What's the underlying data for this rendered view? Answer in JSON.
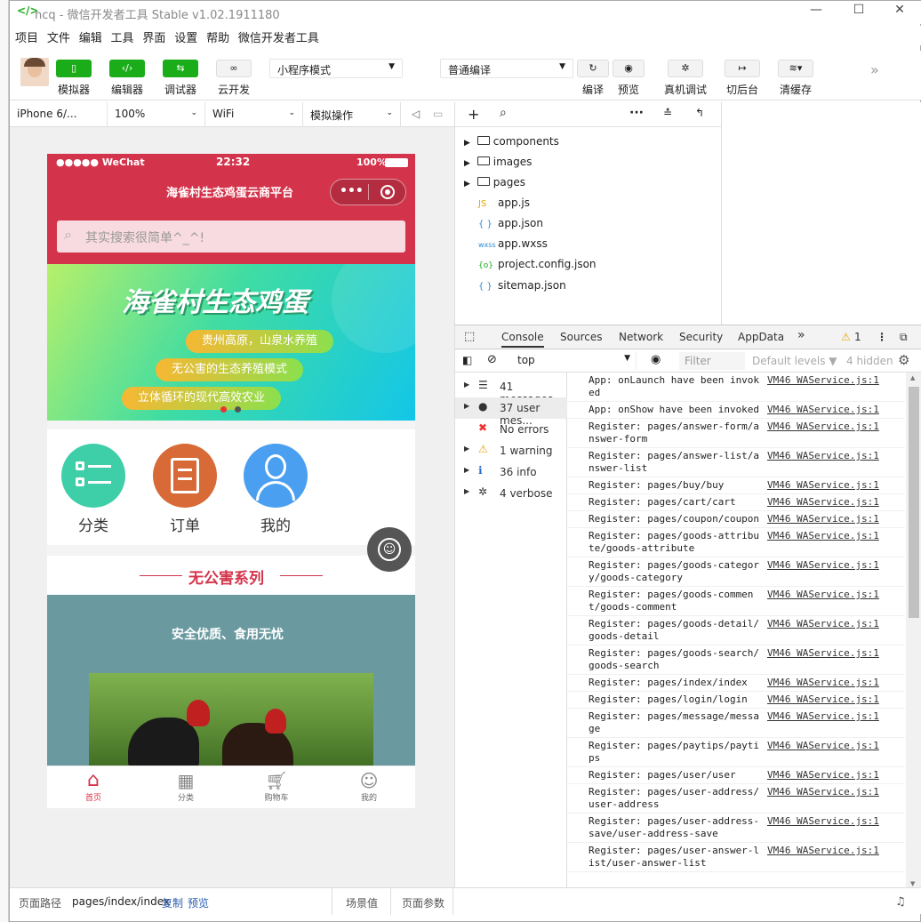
{
  "window": {
    "title": "hcq - 微信开发者工具 Stable v1.02.1911180",
    "logo": "</>"
  },
  "menu": [
    "项目",
    "文件",
    "编辑",
    "工具",
    "界面",
    "设置",
    "帮助",
    "微信开发者工具"
  ],
  "toolbar": {
    "simulator": "模拟器",
    "editor": "编辑器",
    "debugger": "调试器",
    "cloud": "云开发",
    "mode_select": "小程序模式",
    "compile_select": "普通编译",
    "compile": "编译",
    "preview": "预览",
    "remote_debug": "真机调试",
    "backstage": "切后台",
    "clear_cache": "清缓存"
  },
  "sim_header": {
    "device": "iPhone 6/...",
    "zoom": "100%",
    "network": "WiFi",
    "sim_ops": "模拟操作"
  },
  "phone": {
    "status": {
      "carrier": "●●●●● WeChat",
      "time": "22:32",
      "battery": "100%"
    },
    "nav_title": "海雀村生态鸡蛋云商平台",
    "search_placeholder": "其实搜索很简单^_^!",
    "banner": {
      "title": "海雀村生态鸡蛋",
      "line1": "贵州高原，山泉水养殖",
      "line2": "无公害的生态养殖模式",
      "line3": "立体循环的现代高效农业"
    },
    "categories": [
      {
        "label": "分类",
        "color": "#3ecfa9"
      },
      {
        "label": "订单",
        "color": "#d76a37"
      },
      {
        "label": "我的",
        "color": "#4a9ff0"
      }
    ],
    "series_title": "无公害系列",
    "series_subtitle": "安全优质、食用无忧",
    "tabs": [
      {
        "label": "首页",
        "active": true
      },
      {
        "label": "分类"
      },
      {
        "label": "购物车"
      },
      {
        "label": "我的"
      }
    ]
  },
  "files": [
    {
      "name": "components",
      "type": "folder"
    },
    {
      "name": "images",
      "type": "folder"
    },
    {
      "name": "pages",
      "type": "folder"
    },
    {
      "name": "app.js",
      "type": "js",
      "badge": "JS"
    },
    {
      "name": "app.json",
      "type": "json",
      "badge": "{ }"
    },
    {
      "name": "app.wxss",
      "type": "wxss",
      "badge": "wxss"
    },
    {
      "name": "project.config.json",
      "type": "config",
      "badge": "{o}"
    },
    {
      "name": "sitemap.json",
      "type": "json",
      "badge": "{ }"
    }
  ],
  "devtools": {
    "tabs": [
      "Console",
      "Sources",
      "Network",
      "Security",
      "AppData"
    ],
    "warn_count": "1",
    "context": "top",
    "filter_placeholder": "Filter",
    "levels": "Default levels",
    "hidden": "4 hidden",
    "sidebar": [
      "41 messages",
      "37 user mes...",
      "No errors",
      "1 warning",
      "36 info",
      "4 verbose"
    ],
    "logs": [
      {
        "msg": "App: onLaunch have been invoked",
        "src": "VM46 WAService.js:1"
      },
      {
        "msg": "App: onShow have been invoked",
        "src": "VM46 WAService.js:1"
      },
      {
        "msg": "Register: pages/answer-form/answer-form",
        "src": "VM46 WAService.js:1"
      },
      {
        "msg": "Register: pages/answer-list/answer-list",
        "src": "VM46 WAService.js:1"
      },
      {
        "msg": "Register: pages/buy/buy",
        "src": "VM46 WAService.js:1"
      },
      {
        "msg": "Register: pages/cart/cart",
        "src": "VM46 WAService.js:1"
      },
      {
        "msg": "Register: pages/coupon/coupon",
        "src": "VM46 WAService.js:1"
      },
      {
        "msg": "Register: pages/goods-attribute/goods-attribute",
        "src": "VM46 WAService.js:1"
      },
      {
        "msg": "Register: pages/goods-category/goods-category",
        "src": "VM46 WAService.js:1"
      },
      {
        "msg": "Register: pages/goods-comment/goods-comment",
        "src": "VM46 WAService.js:1"
      },
      {
        "msg": "Register: pages/goods-detail/goods-detail",
        "src": "VM46 WAService.js:1"
      },
      {
        "msg": "Register: pages/goods-search/goods-search",
        "src": "VM46 WAService.js:1"
      },
      {
        "msg": "Register: pages/index/index",
        "src": "VM46 WAService.js:1"
      },
      {
        "msg": "Register: pages/login/login",
        "src": "VM46 WAService.js:1"
      },
      {
        "msg": "Register: pages/message/message",
        "src": "VM46 WAService.js:1"
      },
      {
        "msg": "Register: pages/paytips/paytips",
        "src": "VM46 WAService.js:1"
      },
      {
        "msg": "Register: pages/user/user",
        "src": "VM46 WAService.js:1"
      },
      {
        "msg": "Register: pages/user-address/user-address",
        "src": "VM46 WAService.js:1"
      },
      {
        "msg": "Register: pages/user-address-save/user-address-save",
        "src": "VM46 WAService.js:1"
      },
      {
        "msg": "Register: pages/user-answer-list/user-answer-list",
        "src": "VM46 WAService.js:1"
      }
    ]
  },
  "bottombar": {
    "path_label": "页面路径",
    "path": "pages/index/index",
    "copy": "复制",
    "preview": "预览",
    "scene": "场景值",
    "params": "页面参数"
  }
}
